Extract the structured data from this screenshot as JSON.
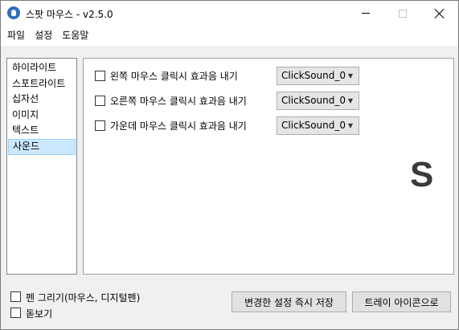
{
  "window": {
    "title": "스팟 마우스 - v2.5.0"
  },
  "menu": {
    "items": [
      "파일",
      "설정",
      "도움말"
    ]
  },
  "sidebar": {
    "items": [
      "하이라이트",
      "스포트라이트",
      "십자선",
      "이미지",
      "텍스트",
      "사운드"
    ],
    "selected": "사운드"
  },
  "sound": {
    "rows": [
      {
        "label": "왼쪽 마우스 클릭시 효과음 내기",
        "checked": false,
        "value": "ClickSound_0"
      },
      {
        "label": "오른쪽 마우스 클릭시 효과음 내기",
        "checked": false,
        "value": "ClickSound_0"
      },
      {
        "label": "가운데 마우스 클릭시 효과음 내기",
        "checked": false,
        "value": "ClickSound_0"
      }
    ],
    "indicator": "S"
  },
  "bottom": {
    "pen_label": "펜 그리기(마우스, 디지털펜)",
    "magnifier_label": "돋보기",
    "save_button": "변경한 설정 즉시 저장",
    "tray_button": "트레이 아이콘으로"
  },
  "colors": {
    "selected_bg": "#cce8ff",
    "app_icon": "#2f6fb8"
  }
}
